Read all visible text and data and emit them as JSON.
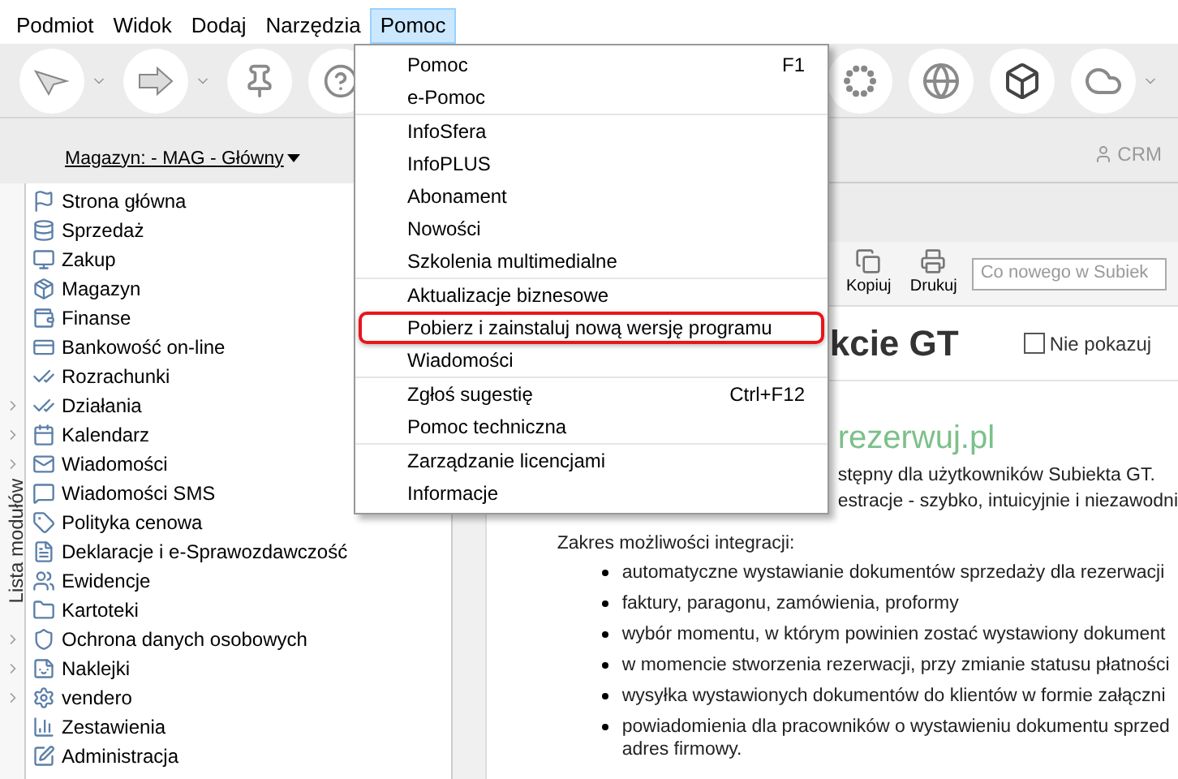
{
  "menu_bar": [
    {
      "label": "Podmiot",
      "selected": false
    },
    {
      "label": "Widok",
      "selected": false
    },
    {
      "label": "Dodaj",
      "selected": false
    },
    {
      "label": "Narzędzia",
      "selected": false
    },
    {
      "label": "Pomoc",
      "selected": true
    }
  ],
  "open_menu": {
    "groups": [
      {
        "items": [
          {
            "label": "Pomoc",
            "shortcut": "F1",
            "highlighted": false
          },
          {
            "label": "e-Pomoc",
            "highlighted": false
          }
        ]
      },
      {
        "items": [
          {
            "label": "InfoSfera",
            "highlighted": false
          },
          {
            "label": "InfoPLUS",
            "highlighted": false
          },
          {
            "label": "Abonament",
            "highlighted": false
          },
          {
            "label": "Nowości",
            "highlighted": false
          },
          {
            "label": "Szkolenia multimedialne",
            "highlighted": false
          }
        ]
      },
      {
        "items": [
          {
            "label": "Aktualizacje biznesowe",
            "highlighted": false
          },
          {
            "label": "Pobierz i zainstaluj nową wersję programu",
            "highlighted": true
          },
          {
            "label": "Wiadomości",
            "highlighted": false
          }
        ]
      },
      {
        "items": [
          {
            "label": "Zgłoś sugestię",
            "shortcut": "Ctrl+F12",
            "highlighted": false
          },
          {
            "label": "Pomoc techniczna",
            "highlighted": false
          }
        ]
      },
      {
        "items": [
          {
            "label": "Zarządzanie licencjami",
            "highlighted": false
          },
          {
            "label": "Informacje",
            "highlighted": false
          }
        ]
      }
    ]
  },
  "store_selector": "Magazyn: - MAG - Główny",
  "crm_button": "CRM",
  "sidebar": {
    "tab_label": "Lista modułów",
    "items": [
      {
        "label": "Strona główna",
        "expandable": false
      },
      {
        "label": "Sprzedaż",
        "expandable": false
      },
      {
        "label": "Zakup",
        "expandable": false
      },
      {
        "label": "Magazyn",
        "expandable": false
      },
      {
        "label": "Finanse",
        "expandable": false
      },
      {
        "label": "Bankowość on-line",
        "expandable": false
      },
      {
        "label": "Rozrachunki",
        "expandable": false
      },
      {
        "label": "Działania",
        "expandable": true
      },
      {
        "label": "Kalendarz",
        "expandable": true
      },
      {
        "label": "Wiadomości",
        "expandable": true
      },
      {
        "label": "Wiadomości SMS",
        "expandable": false
      },
      {
        "label": "Polityka cenowa",
        "expandable": false
      },
      {
        "label": "Deklaracje i e-Sprawozdawczość",
        "expandable": false
      },
      {
        "label": "Ewidencje",
        "expandable": false
      },
      {
        "label": "Kartoteki",
        "expandable": false
      },
      {
        "label": "Ochrona danych osobowych",
        "expandable": true
      },
      {
        "label": "Naklejki",
        "expandable": true
      },
      {
        "label": "vendero",
        "expandable": true
      },
      {
        "label": "Zestawienia",
        "expandable": false
      },
      {
        "label": "Administracja",
        "expandable": false
      }
    ]
  },
  "content": {
    "toolbar_buttons": [
      "Kopiuj",
      "Drukuj"
    ],
    "search": {
      "placeholder": "Co nowego w Subiek"
    },
    "title": "kcie GT",
    "dont_show": {
      "label": "Nie pokazuj",
      "checked": false
    },
    "heading": "rezerwuj.pl",
    "intro_lines": [
      "stępny dla użytkowników Subiekta GT.",
      "estracje - szybko, intuicyjnie i niezawodni"
    ],
    "list_title": "Zakres możliwości integracji:",
    "bullets": [
      "automatyczne wystawianie dokumentów sprzedaży dla rezerwacji",
      "faktury, paragonu, zamówienia, proformy",
      "wybór momentu, w którym powinien zostać wystawiony dokument",
      "w momencie stworzenia rezerwacji, przy zmianie statusu płatności",
      "wysyłka wystawionych dokumentów do klientów w formie załączni",
      "powiadomienia dla pracowników o wystawieniu dokumentu sprzed adres firmowy."
    ]
  }
}
